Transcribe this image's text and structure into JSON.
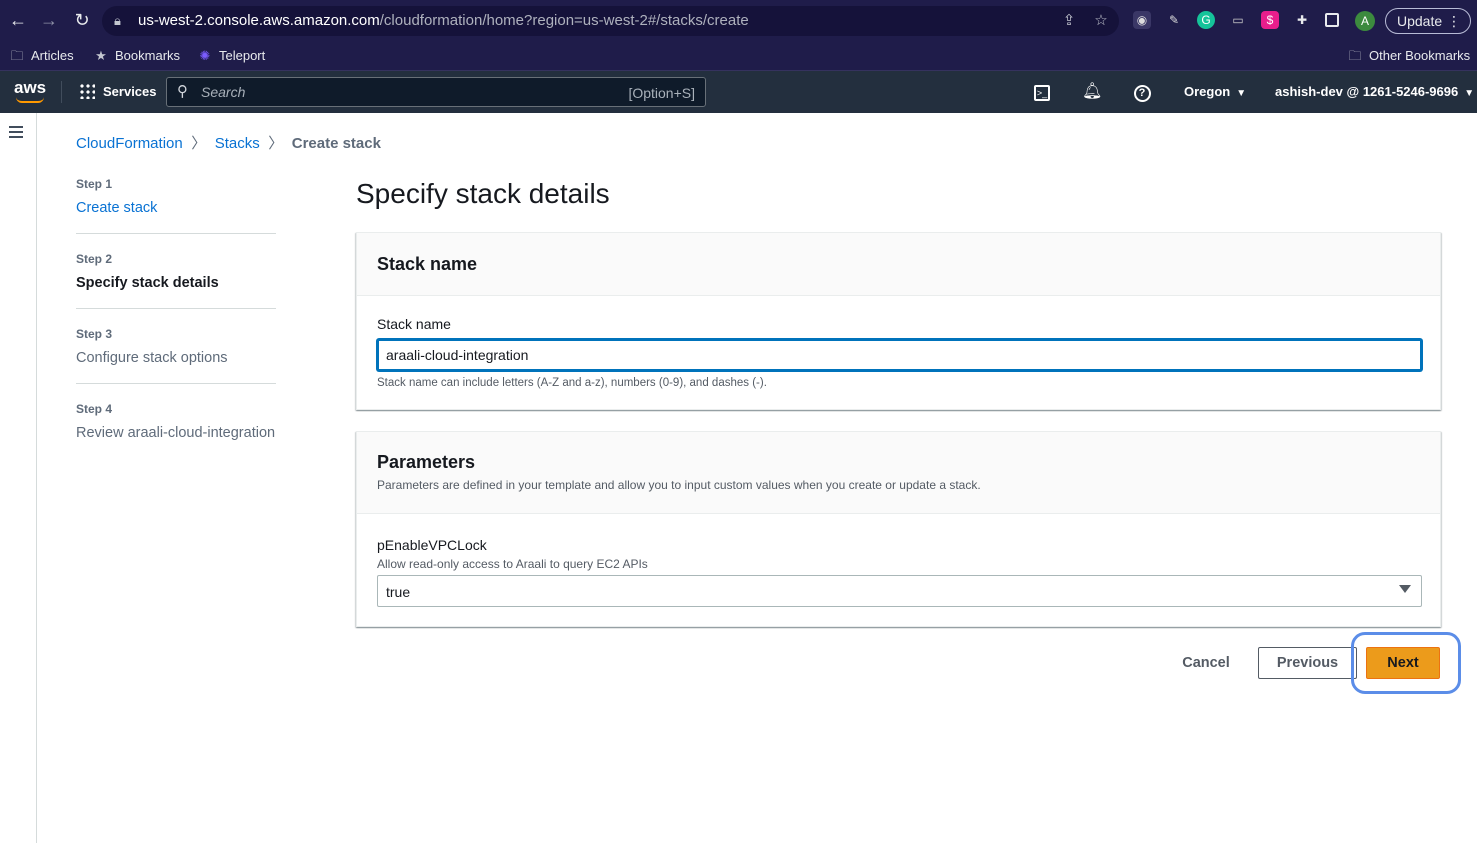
{
  "browser": {
    "url_host": "us-west-2.console.aws.amazon.com",
    "url_path": "/cloudformation/home?region=us-west-2#/stacks/create",
    "avatar_letter": "A",
    "update_label": "Update",
    "bookmarks": {
      "articles": "Articles",
      "bookmarks": "Bookmarks",
      "teleport": "Teleport",
      "other": "Other Bookmarks"
    }
  },
  "console": {
    "services_label": "Services",
    "search_placeholder": "Search",
    "search_shortcut": "[Option+S]",
    "region": "Oregon",
    "account": "ashish-dev @ 1261-5246-9696",
    "accent_color": "#ff9900"
  },
  "breadcrumb": {
    "root": "CloudFormation",
    "stacks": "Stacks",
    "current": "Create stack"
  },
  "steps": [
    {
      "number": "Step 1",
      "title": "Create stack"
    },
    {
      "number": "Step 2",
      "title": "Specify stack details"
    },
    {
      "number": "Step 3",
      "title": "Configure stack options"
    },
    {
      "number": "Step 4",
      "title": "Review araali-cloud-integration"
    }
  ],
  "main": {
    "page_title": "Specify stack details",
    "stack_name_panel": {
      "title": "Stack name",
      "field_label": "Stack name",
      "value": "araali-cloud-integration",
      "hint": "Stack name can include letters (A-Z and a-z), numbers (0-9), and dashes (-)."
    },
    "parameters_panel": {
      "title": "Parameters",
      "description": "Parameters are defined in your template and allow you to input custom values when you create or update a stack.",
      "param_name": "pEnableVPCLock",
      "param_description": "Allow read-only access to Araali to query EC2 APIs",
      "param_value": "true"
    }
  },
  "actions": {
    "cancel": "Cancel",
    "previous": "Previous",
    "next": "Next"
  }
}
